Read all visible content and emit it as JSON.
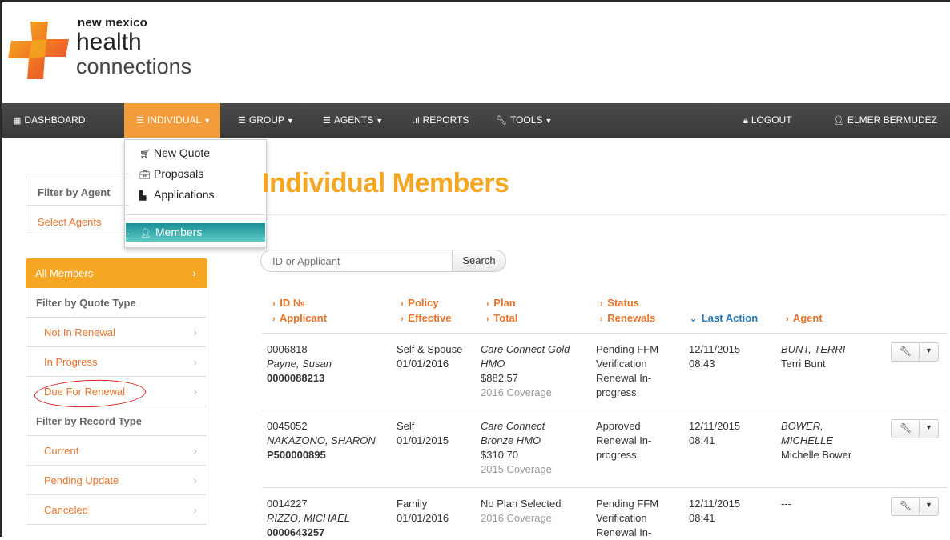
{
  "logo": {
    "line1": "new mexico",
    "line2": "health",
    "line3": "connections"
  },
  "nav": {
    "dashboard": "DASHBOARD",
    "individual": "INDIVIDUAL",
    "group": "GROUP",
    "agents": "AGENTS",
    "reports": "REPORTS",
    "tools": "TOOLS",
    "logout": "LOGOUT",
    "user": "ELMER BERMUDEZ"
  },
  "dropdown": {
    "new_quote": "New Quote",
    "proposals": "Proposals",
    "applications": "Applications",
    "members": "Members"
  },
  "agent_filter": {
    "title": "Filter by Agent",
    "link": "Select Agents"
  },
  "sidebar": {
    "all_members": "All Members",
    "quote_type_title": "Filter by Quote Type",
    "not_in_renewal": "Not In Renewal",
    "in_progress": "In Progress",
    "due_for_renewal": "Due For Renewal",
    "record_type_title": "Filter by Record Type",
    "current": "Current",
    "pending_update": "Pending Update",
    "canceled": "Canceled"
  },
  "main": {
    "title": "Individual Members",
    "search_placeholder": "ID or Applicant",
    "search_button": "Search"
  },
  "table": {
    "headers": {
      "id": "ID №",
      "applicant": "Applicant",
      "policy": "Policy",
      "effective": "Effective",
      "plan": "Plan",
      "total": "Total",
      "status": "Status",
      "renewals": "Renewals",
      "last_action": "Last Action",
      "agent": "Agent"
    },
    "rows": [
      {
        "id": "0006818",
        "applicant": "Payne, Susan",
        "member_id": "0000088213",
        "policy": "Self & Spouse",
        "effective": "01/01/2016",
        "plan_line1": "Care Connect Gold",
        "plan_line2": "HMO",
        "total": "$882.57",
        "coverage": "2016 Coverage",
        "status_line1": "Pending FFM",
        "status_line2": "Verification",
        "renewal_line1": "Renewal In-",
        "renewal_line2": "progress",
        "last_date": "12/11/2015",
        "last_time": "08:43",
        "agent_line1": "BUNT, TERRI",
        "agent_line2": "",
        "agent_name": "Terri Bunt"
      },
      {
        "id": "0045052",
        "applicant": "NAKAZONO, SHARON",
        "member_id": "P500000895",
        "policy": "Self",
        "effective": "01/01/2015",
        "plan_line1": "Care Connect",
        "plan_line2": "Bronze HMO",
        "total": "$310.70",
        "coverage": "2015 Coverage",
        "status_line1": "Approved",
        "status_line2": "Renewal In-",
        "renewal_line1": "progress",
        "renewal_line2": "",
        "last_date": "12/11/2015",
        "last_time": "08:41",
        "agent_line1": "BOWER,",
        "agent_line2": "MICHELLE",
        "agent_name": "Michelle Bower"
      },
      {
        "id": "0014227",
        "applicant": "RIZZO, MICHAEL",
        "member_id": "0000643257",
        "policy": "Family",
        "effective": "01/01/2016",
        "plan_line1": "No Plan Selected",
        "plan_line2": "",
        "total": "",
        "coverage": "2016 Coverage",
        "status_line1": "Pending FFM",
        "status_line2": "Verification",
        "renewal_line1": "Renewal In-",
        "renewal_line2": "",
        "last_date": "12/11/2015",
        "last_time": "08:41",
        "agent_line1": "---",
        "agent_line2": "",
        "agent_name": ""
      }
    ]
  },
  "colors": {
    "accent_orange": "#f5a623",
    "link_orange": "#e8742b",
    "nav_dark": "#3f3f3f",
    "members_teal": "#1a8f96",
    "annotation_red": "#d62020"
  }
}
